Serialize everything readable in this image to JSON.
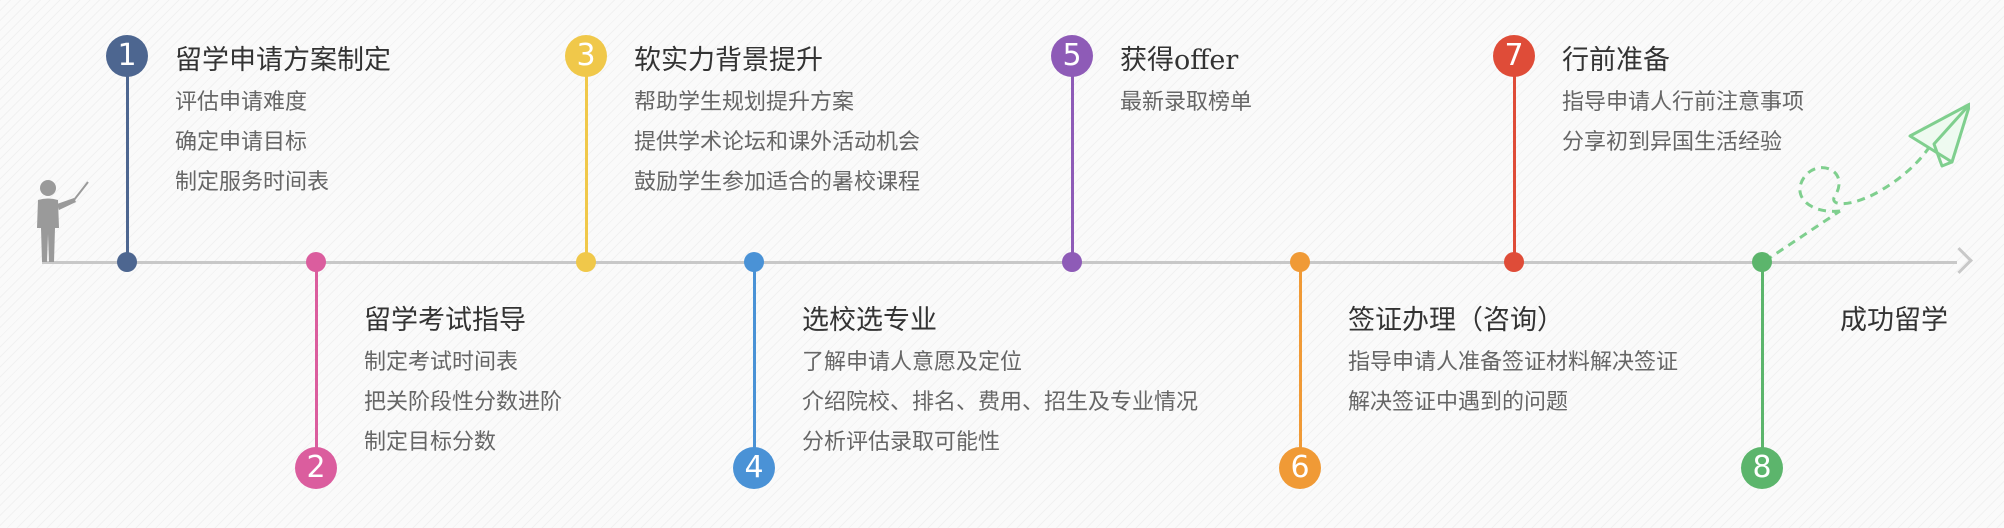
{
  "colors": {
    "axis": "#c8c8c8",
    "title_text": "#333333",
    "body_text": "#666666",
    "figure": "#9a9a9a",
    "plane": "#7fcf8e"
  },
  "steps": [
    {
      "number": "1",
      "color": "#4d6690",
      "title": "留学申请方案制定",
      "lines": [
        "评估申请难度",
        "确定申请目标",
        "制定服务时间表"
      ]
    },
    {
      "number": "2",
      "color": "#db5d9e",
      "title": "留学考试指导",
      "lines": [
        "制定考试时间表",
        "把关阶段性分数进阶",
        "制定目标分数"
      ]
    },
    {
      "number": "3",
      "color": "#f0c84a",
      "title": "软实力背景提升",
      "lines": [
        "帮助学生规划提升方案",
        "提供学术论坛和课外活动机会",
        "鼓励学生参加适合的暑校课程"
      ]
    },
    {
      "number": "4",
      "color": "#4a92d6",
      "title": "选校选专业",
      "lines": [
        "了解申请人意愿及定位",
        "介绍院校、排名、费用、招生及专业情况",
        "分析评估录取可能性"
      ]
    },
    {
      "number": "5",
      "color": "#8e5bb7",
      "title": "获得offer",
      "lines": [
        "最新录取榜单"
      ]
    },
    {
      "number": "6",
      "color": "#f09a36",
      "title": "签证办理（咨询）",
      "lines": [
        "指导申请人准备签证材料解决签证",
        "解决签证中遇到的问题"
      ]
    },
    {
      "number": "7",
      "color": "#df4c38",
      "title": "行前准备",
      "lines": [
        "指导申请人行前注意事项",
        "分享初到异国生活经验"
      ]
    },
    {
      "number": "8",
      "color": "#5cb56c",
      "title": "成功留学",
      "lines": []
    }
  ]
}
